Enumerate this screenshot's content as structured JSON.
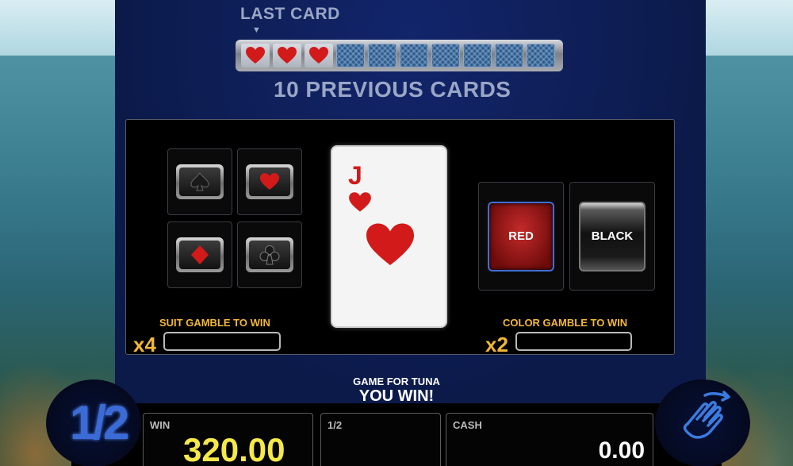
{
  "history": {
    "last_card_label": "LAST CARD",
    "previous_label": "10 PREVIOUS CARDS",
    "slots": [
      "heart",
      "heart",
      "heart",
      "back",
      "back",
      "back",
      "back",
      "back",
      "back",
      "back"
    ]
  },
  "suits": {
    "items": [
      {
        "name": "spade",
        "color": "#1a1a1a"
      },
      {
        "name": "heart",
        "color": "#d21a1a"
      },
      {
        "name": "diamond",
        "color": "#d21a1a"
      },
      {
        "name": "club",
        "color": "#1a1a1a"
      }
    ],
    "label": "SUIT GAMBLE TO WIN",
    "multiplier": "x4",
    "value": ""
  },
  "card": {
    "rank": "J",
    "suit": "heart",
    "color": "#d21a1a"
  },
  "colors": {
    "red_label": "RED",
    "black_label": "BLACK",
    "label": "COLOR GAMBLE TO WIN",
    "multiplier": "x2",
    "value": ""
  },
  "message": {
    "line1": "GAME FOR TUNA",
    "line2": "YOU WIN!"
  },
  "stats": {
    "win_label": "WIN",
    "win_value": "320.00",
    "half_label": "1/2",
    "half_value": "",
    "cash_label": "CASH",
    "cash_value": "0.00"
  },
  "half_gamble_badge": "1/2",
  "theme": {
    "accent_gold": "#f2b73a",
    "win_yellow": "#f5e94a",
    "heart_red": "#d21a1a",
    "select_blue": "#3d6fd6"
  }
}
